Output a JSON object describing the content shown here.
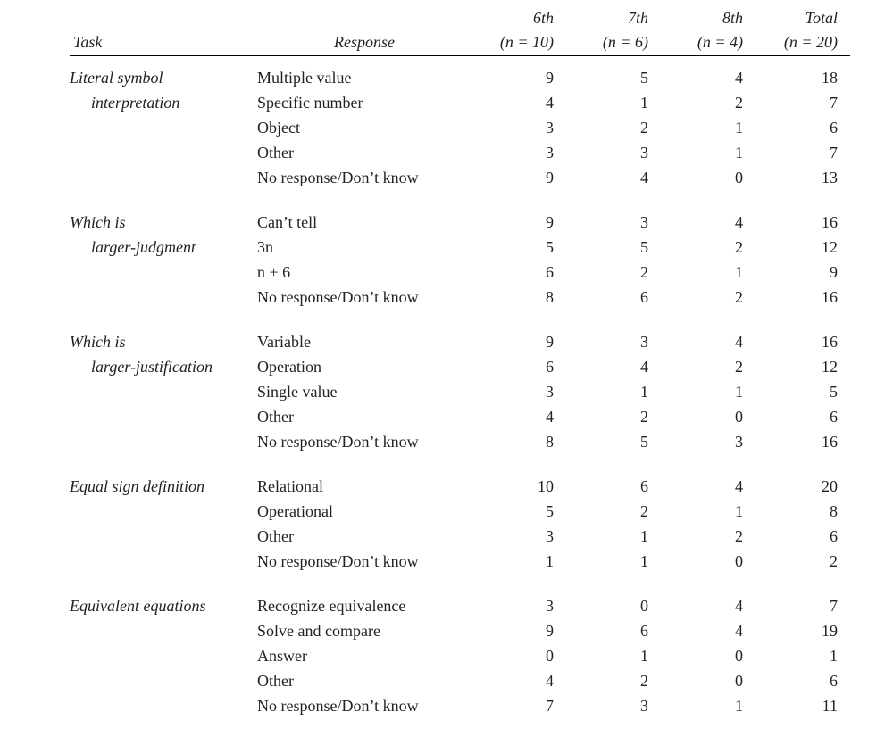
{
  "header": {
    "task_label": "Task",
    "response_label": "Response",
    "col1_top": "6th",
    "col1_bot": "(n = 10)",
    "col2_top": "7th",
    "col2_bot": "(n = 6)",
    "col3_top": "8th",
    "col3_bot": "(n = 4)",
    "col4_top": "Total",
    "col4_bot": "(n = 20)"
  },
  "groups": [
    {
      "task_line1": "Literal symbol",
      "task_line2": "interpretation",
      "rows": [
        {
          "response": "Multiple value",
          "c1": "9",
          "c2": "5",
          "c3": "4",
          "c4": "18"
        },
        {
          "response": "Specific number",
          "c1": "4",
          "c2": "1",
          "c3": "2",
          "c4": "7"
        },
        {
          "response": "Object",
          "c1": "3",
          "c2": "2",
          "c3": "1",
          "c4": "6"
        },
        {
          "response": "Other",
          "c1": "3",
          "c2": "3",
          "c3": "1",
          "c4": "7"
        },
        {
          "response": "No response/Don’t know",
          "c1": "9",
          "c2": "4",
          "c3": "0",
          "c4": "13"
        }
      ]
    },
    {
      "task_line1": "Which is",
      "task_line2": "larger-judgment",
      "rows": [
        {
          "response": "Can’t tell",
          "c1": "9",
          "c2": "3",
          "c3": "4",
          "c4": "16"
        },
        {
          "response": "3n",
          "c1": "5",
          "c2": "5",
          "c3": "2",
          "c4": "12"
        },
        {
          "response": "n + 6",
          "c1": "6",
          "c2": "2",
          "c3": "1",
          "c4": "9"
        },
        {
          "response": "No response/Don’t know",
          "c1": "8",
          "c2": "6",
          "c3": "2",
          "c4": "16"
        }
      ]
    },
    {
      "task_line1": "Which is",
      "task_line2": "larger-justification",
      "rows": [
        {
          "response": "Variable",
          "c1": "9",
          "c2": "3",
          "c3": "4",
          "c4": "16"
        },
        {
          "response": "Operation",
          "c1": "6",
          "c2": "4",
          "c3": "2",
          "c4": "12"
        },
        {
          "response": "Single value",
          "c1": "3",
          "c2": "1",
          "c3": "1",
          "c4": "5"
        },
        {
          "response": "Other",
          "c1": "4",
          "c2": "2",
          "c3": "0",
          "c4": "6"
        },
        {
          "response": "No response/Don’t know",
          "c1": "8",
          "c2": "5",
          "c3": "3",
          "c4": "16"
        }
      ]
    },
    {
      "task_line1": "Equal sign definition",
      "task_line2": "",
      "rows": [
        {
          "response": "Relational",
          "c1": "10",
          "c2": "6",
          "c3": "4",
          "c4": "20"
        },
        {
          "response": "Operational",
          "c1": "5",
          "c2": "2",
          "c3": "1",
          "c4": "8"
        },
        {
          "response": "Other",
          "c1": "3",
          "c2": "1",
          "c3": "2",
          "c4": "6"
        },
        {
          "response": "No response/Don’t know",
          "c1": "1",
          "c2": "1",
          "c3": "0",
          "c4": "2"
        }
      ]
    },
    {
      "task_line1": "Equivalent equations",
      "task_line2": "",
      "rows": [
        {
          "response": "Recognize equivalence",
          "c1": "3",
          "c2": "0",
          "c3": "4",
          "c4": "7"
        },
        {
          "response": "Solve and compare",
          "c1": "9",
          "c2": "6",
          "c3": "4",
          "c4": "19"
        },
        {
          "response": "Answer",
          "c1": "0",
          "c2": "1",
          "c3": "0",
          "c4": "1"
        },
        {
          "response": "Other",
          "c1": "4",
          "c2": "2",
          "c3": "0",
          "c4": "6"
        },
        {
          "response": "No response/Don’t know",
          "c1": "7",
          "c2": "3",
          "c3": "1",
          "c4": "11"
        }
      ]
    }
  ]
}
